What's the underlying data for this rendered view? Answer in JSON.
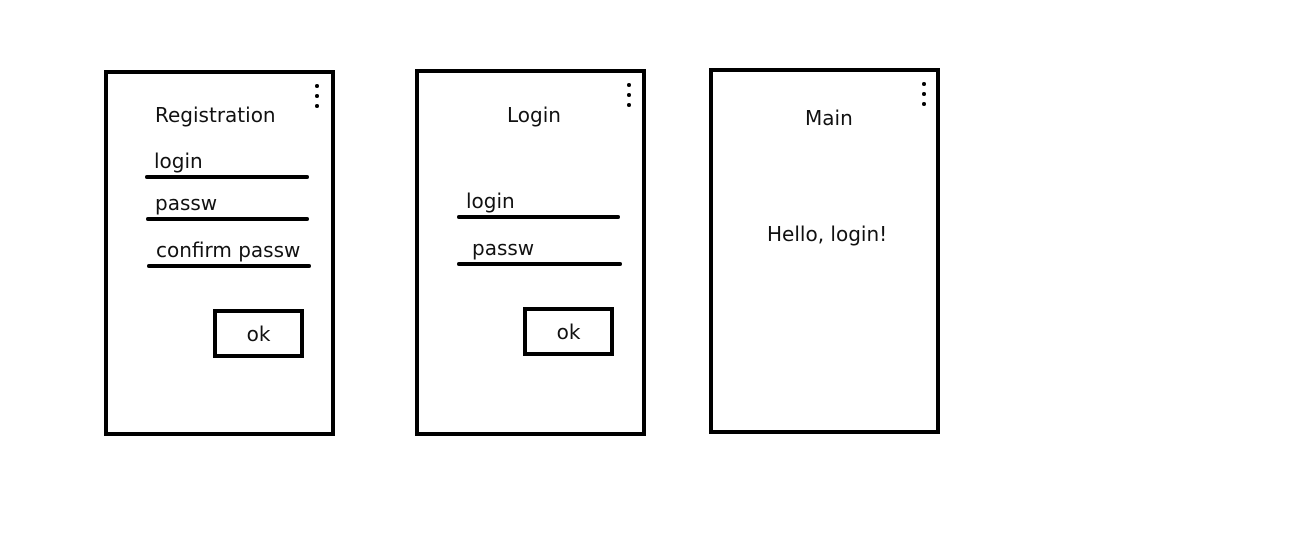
{
  "registration": {
    "title": "Registration",
    "fields": [
      {
        "label": "login"
      },
      {
        "label": "passw"
      },
      {
        "label": "confirm passw"
      }
    ],
    "ok_label": "ok",
    "menu_icon": "more-vertical-icon"
  },
  "login": {
    "title": "Login",
    "fields": [
      {
        "label": "login"
      },
      {
        "label": "passw"
      }
    ],
    "ok_label": "ok",
    "menu_icon": "more-vertical-icon"
  },
  "main": {
    "title": "Main",
    "greeting": "Hello, login!",
    "menu_icon": "more-vertical-icon"
  }
}
